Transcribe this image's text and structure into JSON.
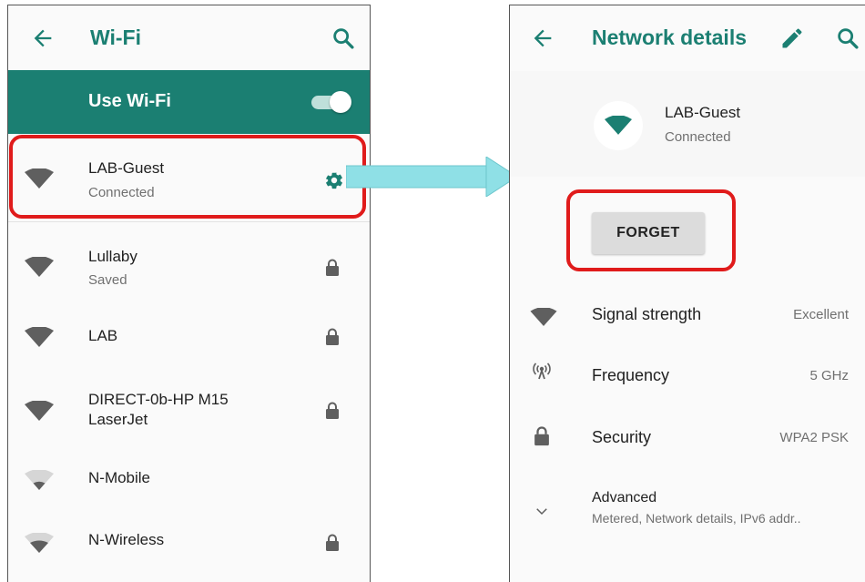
{
  "wifi_screen": {
    "title": "Wi-Fi",
    "toggle_label": "Use Wi-Fi",
    "toggle_on": true,
    "networks": [
      {
        "name": "LAB-Guest",
        "status": "Connected",
        "signal_icon": "wifi-strong-icon",
        "action_icon": "gear-icon"
      },
      {
        "name": "Lullaby",
        "status": "Saved",
        "signal_icon": "wifi-strong-icon",
        "action_icon": "lock-icon"
      },
      {
        "name": "LAB",
        "status": "",
        "signal_icon": "wifi-strong-icon",
        "action_icon": "lock-icon"
      },
      {
        "name": "DIRECT-0b-HP M15\nLaserJet",
        "status": "",
        "signal_icon": "wifi-strong-icon",
        "action_icon": "lock-icon"
      },
      {
        "name": "N-Mobile",
        "status": "",
        "signal_icon": "wifi-weak-icon",
        "action_icon": ""
      },
      {
        "name": "N-Wireless",
        "status": "",
        "signal_icon": "wifi-weak-icon",
        "action_icon": "lock-icon"
      }
    ]
  },
  "details_screen": {
    "title": "Network details",
    "network_name": "LAB-Guest",
    "network_status": "Connected",
    "forget_label": "FORGET",
    "rows": [
      {
        "label": "Signal strength",
        "value": "Excellent",
        "icon": "wifi-icon"
      },
      {
        "label": "Frequency",
        "value": "5 GHz",
        "icon": "antenna-icon"
      },
      {
        "label": "Security",
        "value": "WPA2 PSK",
        "icon": "lock-icon"
      }
    ],
    "advanced": {
      "label": "Advanced",
      "summary": "Metered, Network details, IPv6 addr..",
      "icon": "chevron-down-icon"
    }
  },
  "colors": {
    "accent": "#1b7f72",
    "highlight": "#e01b1b",
    "arrow": "#8fe0e6"
  }
}
